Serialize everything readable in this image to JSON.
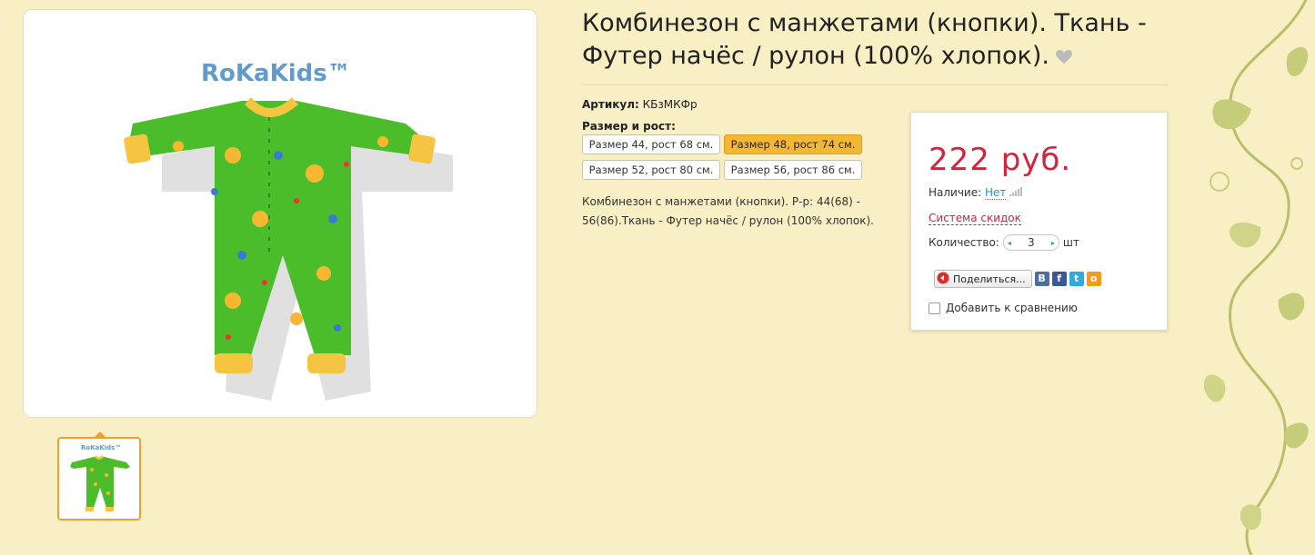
{
  "product": {
    "title": "Комбинезон с манжетами (кнопки). Ткань - Футер начёс / рулон (100% хлопок).",
    "brand_logo": "RoKaKids™",
    "sku_label": "Артикул:",
    "sku_value": "КБзМКФр",
    "size_label": "Размер и рост:",
    "sizes": [
      "Размер 44, рост 68 см.",
      "Размер 48, рост 74 см.",
      "Размер 52, рост 80 см.",
      "Размер 56, рост 86 см."
    ],
    "selected_size_index": 1,
    "description": "Комбинезон с манжетами (кнопки). Р-р: 44(68) - 56(86).Ткань - Футер начёс / рулон (100% хлопок)."
  },
  "buybox": {
    "price": "222 руб.",
    "availability_label": "Наличие:",
    "availability_value": "Нет",
    "discount_link": "Система скидок",
    "quantity_label": "Количество:",
    "quantity_value": "3",
    "quantity_unit": "шт",
    "share_label": "Поделиться...",
    "compare_label": "Добавить к сравнению"
  },
  "colors": {
    "background": "#f8efc4",
    "price": "#d4243c",
    "selected_size": "#f4b733",
    "thumb_border": "#f0a030",
    "link": "#2a8fc8"
  },
  "icons": [
    "heart-icon",
    "vk-icon",
    "facebook-icon",
    "twitter-icon",
    "odnoklassniki-icon",
    "signal-bars-icon"
  ]
}
